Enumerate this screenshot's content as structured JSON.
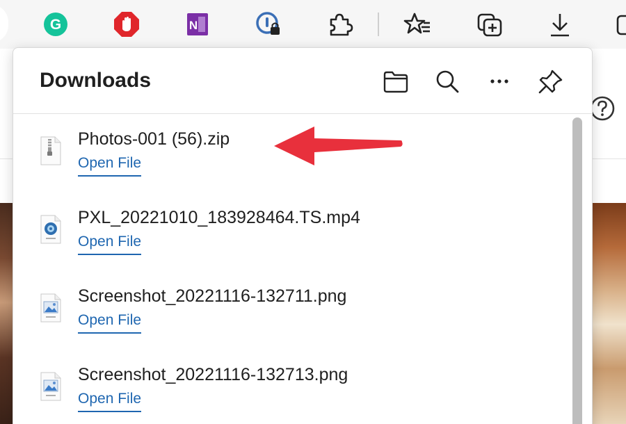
{
  "toolbar": {
    "icons": [
      "grammarly-icon",
      "adblock-icon",
      "onenote-icon",
      "password-manager-icon",
      "extensions-icon",
      "favorites-icon",
      "collections-icon",
      "downloads-icon",
      "screenshot-icon"
    ]
  },
  "panel": {
    "title": "Downloads",
    "actions": [
      "open-folder-icon",
      "search-icon",
      "more-options-icon",
      "pin-icon"
    ]
  },
  "downloads": [
    {
      "filename": "Photos-001 (56).zip",
      "action": "Open File",
      "type": "zip"
    },
    {
      "filename": "PXL_20221010_183928464.TS.mp4",
      "action": "Open File",
      "type": "mp4"
    },
    {
      "filename": "Screenshot_20221116-132711.png",
      "action": "Open File",
      "type": "png"
    },
    {
      "filename": "Screenshot_20221116-132713.png",
      "action": "Open File",
      "type": "png"
    }
  ],
  "colors": {
    "link": "#1e66b0",
    "annotation_arrow": "#e8303c",
    "grammarly": "#15c39a",
    "adblock": "#e0262b",
    "onenote": "#7b2fa6"
  }
}
